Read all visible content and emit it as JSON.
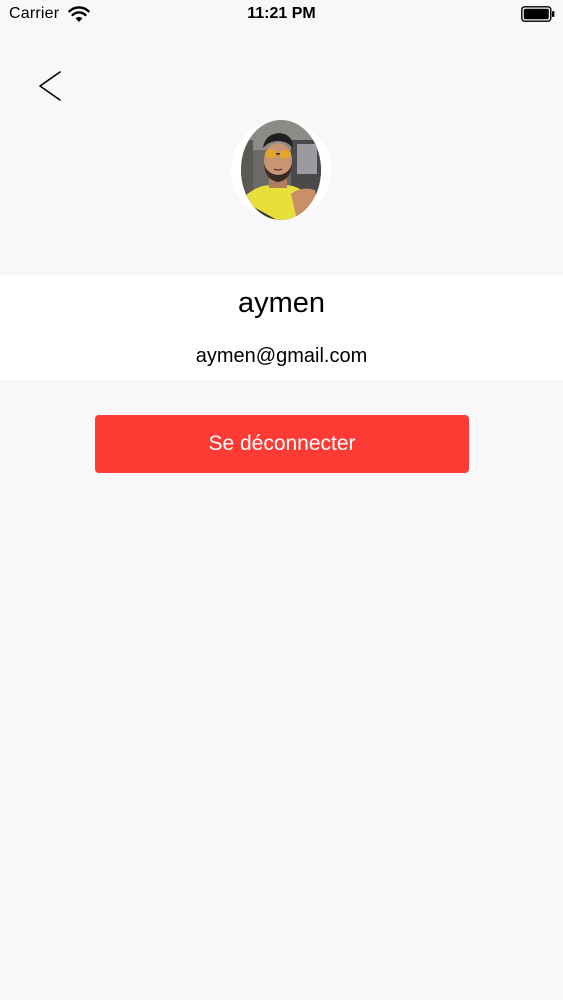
{
  "status_bar": {
    "carrier": "Carrier",
    "time": "11:21 PM",
    "wifi_icon": "wifi-icon",
    "battery_icon": "battery-full-icon"
  },
  "navigation": {
    "back_icon": "chevron-left-icon"
  },
  "profile": {
    "avatar": "user-photo",
    "name": "aymen",
    "email": "aymen@gmail.com"
  },
  "actions": {
    "logout_label": "Se déconnecter"
  },
  "colors": {
    "background": "#f8f7f9",
    "panel": "#ffffff",
    "logout_button": "#fd3a33"
  }
}
